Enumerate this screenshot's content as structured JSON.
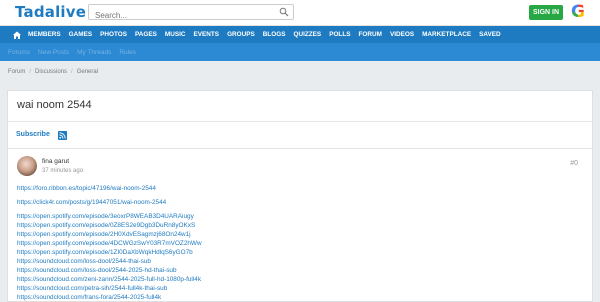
{
  "header": {
    "logo": "Tadalive",
    "search_placeholder": "Search...",
    "signin_label": "SIGN IN",
    "google_letter": "G"
  },
  "nav": {
    "items": [
      "MEMBERS",
      "GAMES",
      "PHOTOS",
      "PAGES",
      "MUSIC",
      "EVENTS",
      "GROUPS",
      "BLOGS",
      "QUIZZES",
      "POLLS",
      "FORUM",
      "VIDEOS",
      "MARKETPLACE",
      "SAVED"
    ],
    "active": "FORUM"
  },
  "subnav": {
    "items": [
      "Forums",
      "New Posts",
      "My Threads",
      "Rules"
    ]
  },
  "breadcrumb": [
    "Forum",
    "Discussions",
    "General"
  ],
  "thread": {
    "title": "wai noom 2544",
    "subscribe_label": "Subscribe"
  },
  "post": {
    "author": "fina garut",
    "time": "37 minutes ago",
    "number": "#0",
    "links_group1": [
      "https://foro.ribbon.es/topic/47196/wai-noom-2544",
      "https://click4r.com/posts/g/19447051/wai-noom-2544"
    ],
    "links_group2": [
      "https://open.spotify.com/episode/3eoxrP8WEAB3D4UARAiugy",
      "https://open.spotify.com/episode/0Z8ES2e9Dgb3DuRn8yOKxS",
      "https://open.spotify.com/episode/2H0XdvESagmzj68On24w1j",
      "https://open.spotify.com/episode/4DCWGzSwY03R7mVOZ2hWw",
      "https://open.spotify.com/episode/1ZI0DaXbWqkHdlqS6yGO7b",
      "https://soundcloud.com/loss-dool/2544-thai-sub",
      "https://soundcloud.com/loss-dool/2544-2025-hd-thai-sub",
      "https://soundcloud.com/zeni-zann/2544-2025-full-hd-1080p-full4k",
      "https://soundcloud.com/petra-sih/2544-full4k-thai-sub",
      "https://soundcloud.com/frans-fora/2544-2025-full4k"
    ]
  },
  "colors": {
    "brand_blue": "#1f7bc1",
    "subnav_blue": "#2b8ad3",
    "signin_green": "#28a745"
  }
}
